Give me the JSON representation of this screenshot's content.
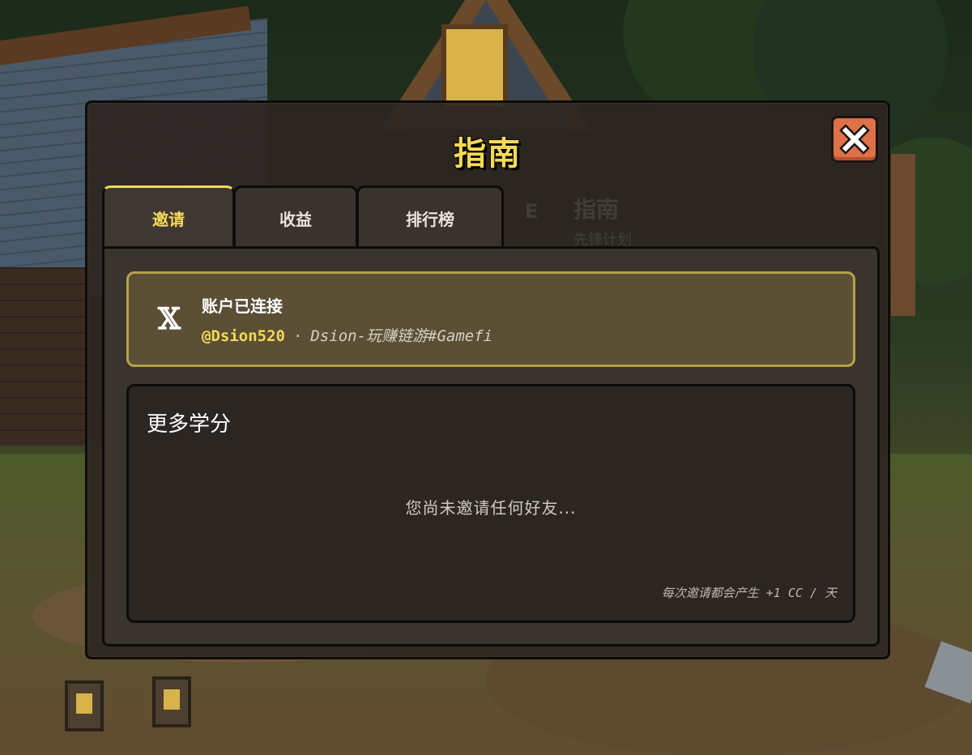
{
  "modal": {
    "title": "指南",
    "close_icon": "close-icon"
  },
  "background_ghost": {
    "key_hint": "E",
    "title": "指南",
    "subtitle": "先锋计划"
  },
  "tabs": [
    {
      "label": "邀请",
      "active": true
    },
    {
      "label": "收益",
      "active": false
    },
    {
      "label": "排行榜",
      "active": false
    }
  ],
  "account": {
    "icon": "x-logo-icon",
    "status": "账户已连接",
    "handle": "@Dsion520",
    "separator": "·",
    "display_name": "Dsion-玩赚链游#Gamefi"
  },
  "credits": {
    "title": "更多学分",
    "empty_message": "您尚未邀请任何好友...",
    "note": "每次邀请都会产生 +1 CC / 天"
  },
  "colors": {
    "accent_yellow": "#f5d957",
    "close_button": "#e07048",
    "card_border": "#b7a14a"
  }
}
